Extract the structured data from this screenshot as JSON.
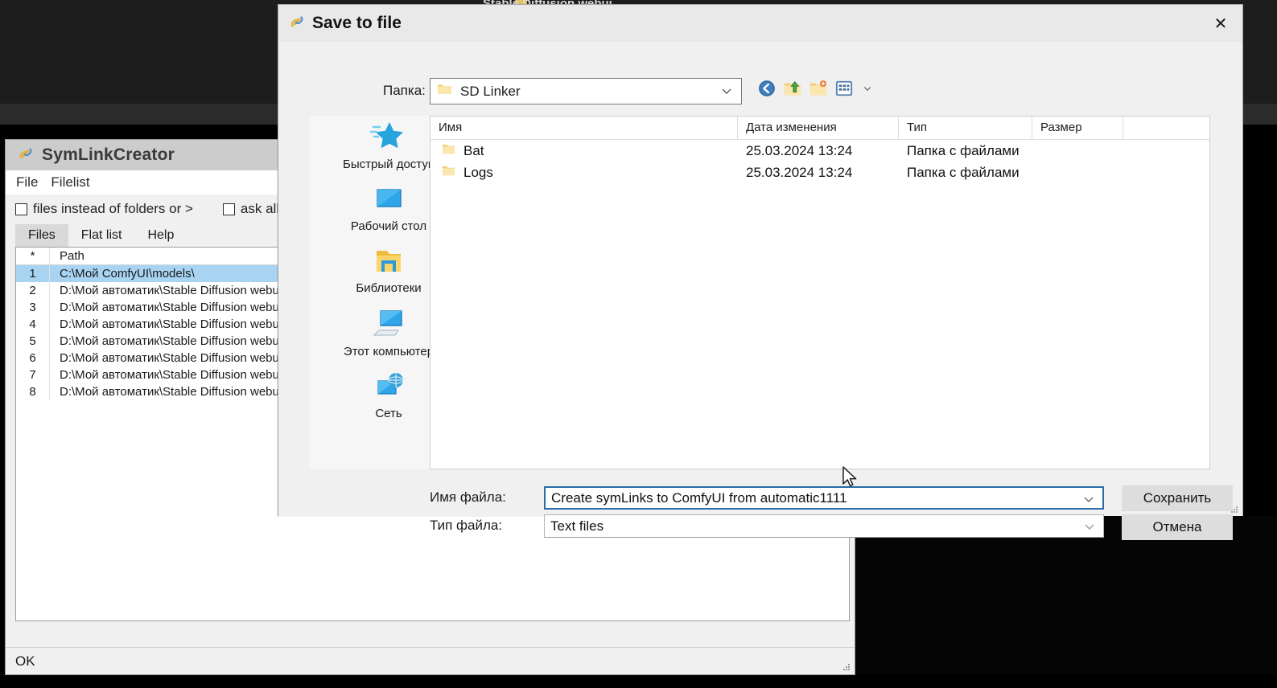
{
  "desktop": {
    "background_app_title": "Stable Diffusion webui",
    "folder_icon": "folder-icon"
  },
  "symlink_window": {
    "title": "SymLinkCreator",
    "title_icon": "link-icon",
    "menu": [
      {
        "label": "File"
      },
      {
        "label": "Filelist"
      }
    ],
    "checkboxes": [
      {
        "label": "files instead of folders or >",
        "checked": false
      },
      {
        "label": "ask all",
        "checked": false
      }
    ],
    "tabs": [
      {
        "label": "Files",
        "active": true
      },
      {
        "label": "Flat list",
        "active": false
      },
      {
        "label": "Help",
        "active": false
      }
    ],
    "grid": {
      "columns": [
        "*",
        "Path"
      ],
      "rows": [
        {
          "n": "1",
          "path": "C:\\Мой ComfyUI\\models\\",
          "selected": true
        },
        {
          "n": "2",
          "path": "D:\\Мой автоматик\\Stable Diffusion webu",
          "selected": false
        },
        {
          "n": "3",
          "path": "D:\\Мой автоматик\\Stable Diffusion webu",
          "selected": false
        },
        {
          "n": "4",
          "path": "D:\\Мой автоматик\\Stable Diffusion webu",
          "selected": false
        },
        {
          "n": "5",
          "path": "D:\\Мой автоматик\\Stable Diffusion webu",
          "selected": false
        },
        {
          "n": "6",
          "path": "D:\\Мой автоматик\\Stable Diffusion webu",
          "selected": false
        },
        {
          "n": "7",
          "path": "D:\\Мой автоматик\\Stable Diffusion webu",
          "selected": false
        },
        {
          "n": "8",
          "path": "D:\\Мой автоматик\\Stable Diffusion webu",
          "selected": false
        }
      ]
    },
    "status": "OK"
  },
  "dialog": {
    "title": "Save to file",
    "title_icon": "link-icon",
    "close_label": "✕",
    "folder": {
      "label": "Папка:",
      "value": "SD Linker",
      "icon": "folder-icon",
      "chevron": "chevron-down-icon"
    },
    "toolbar": [
      {
        "name": "back-icon"
      },
      {
        "name": "up-folder-icon"
      },
      {
        "name": "new-folder-icon"
      },
      {
        "name": "view-options-icon"
      },
      {
        "name": "chevron-down-icon"
      }
    ],
    "places": [
      {
        "label": "Быстрый доступ",
        "icon": "star-icon"
      },
      {
        "label": "Рабочий стол",
        "icon": "desktop-icon"
      },
      {
        "label": "Библиотеки",
        "icon": "libraries-folder-icon"
      },
      {
        "label": "Этот компьютер",
        "icon": "computer-icon"
      },
      {
        "label": "Сеть",
        "icon": "network-icon"
      }
    ],
    "filelist": {
      "columns": [
        "Имя",
        "Дата изменения",
        "Тип",
        "Размер",
        ""
      ],
      "rows": [
        {
          "name": "Bat",
          "date": "25.03.2024 13:24",
          "type": "Папка с файлами",
          "size": "",
          "icon": "folder-icon"
        },
        {
          "name": "Logs",
          "date": "25.03.2024 13:24",
          "type": "Папка с файлами",
          "size": "",
          "icon": "folder-icon"
        }
      ]
    },
    "filename": {
      "label": "Имя файла:",
      "value": "Create symLinks to ComfyUI from automatic1111",
      "placeholder": "",
      "chevron": "chevron-down-icon"
    },
    "filetype": {
      "label": "Тип файла:",
      "value": "Text files",
      "chevron": "chevron-down-icon"
    },
    "save_button": "Сохранить",
    "cancel_button": "Отмена"
  },
  "colors": {
    "accent": "#2a6ca8",
    "selection": "#a8d4f2",
    "folder_yellow": "#f3c65b",
    "button_gray": "#dddddd"
  }
}
